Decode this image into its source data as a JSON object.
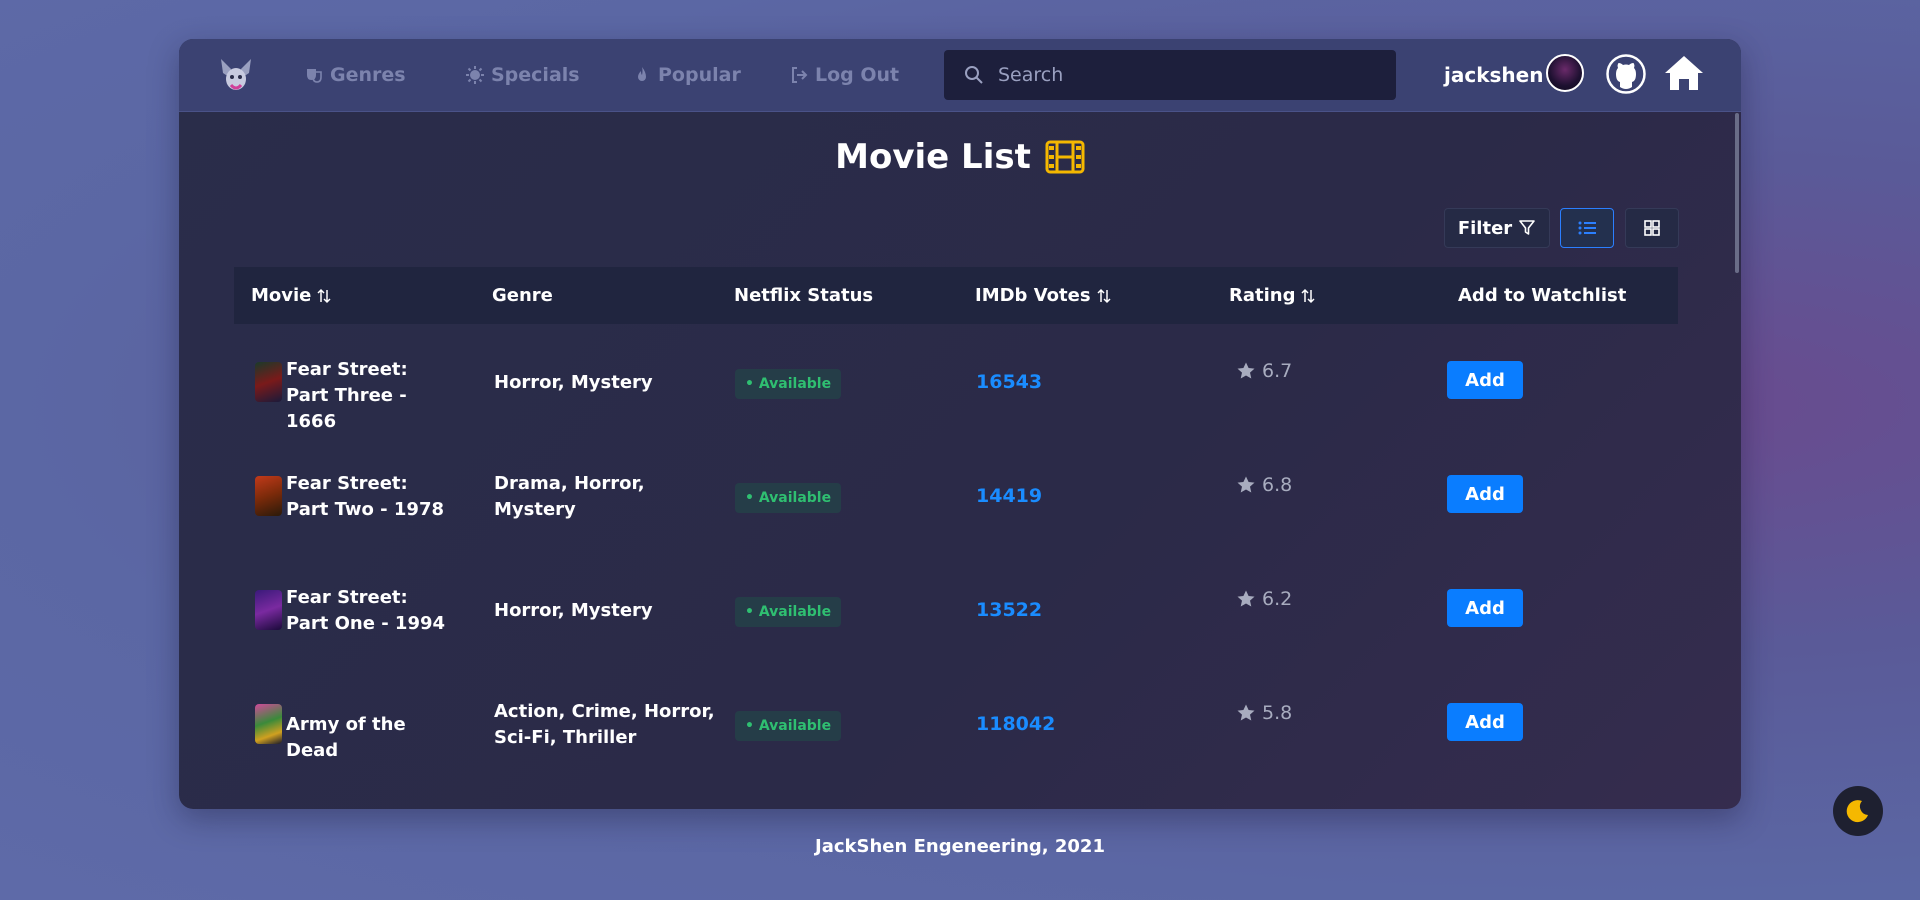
{
  "nav": {
    "genres": "Genres",
    "specials": "Specials",
    "popular": "Popular",
    "logout": "Log Out",
    "search_placeholder": "Search",
    "username": "jackshen"
  },
  "page": {
    "title": "Movie List",
    "filter_label": "Filter"
  },
  "table": {
    "headers": {
      "movie": "Movie",
      "genre": "Genre",
      "status": "Netflix Status",
      "votes": "IMDb Votes",
      "rating": "Rating",
      "watchlist": "Add to Watchlist"
    },
    "rows": [
      {
        "title": "Fear Street: Part Three - 1666",
        "genre": "Horror, Mystery",
        "status": "• Available",
        "votes": "16543",
        "rating": "6.7",
        "action": "Add"
      },
      {
        "title": "Fear Street: Part Two - 1978",
        "genre": "Drama, Horror, Mystery",
        "status": "• Available",
        "votes": "14419",
        "rating": "6.8",
        "action": "Add"
      },
      {
        "title": "Fear Street: Part One - 1994",
        "genre": "Horror, Mystery",
        "status": "• Available",
        "votes": "13522",
        "rating": "6.2",
        "action": "Add"
      },
      {
        "title": "Army of the Dead",
        "genre": "Action, Crime, Horror, Sci-Fi, Thriller",
        "status": "• Available",
        "votes": "118042",
        "rating": "5.8",
        "action": "Add"
      }
    ]
  },
  "footer": {
    "text": "JackShen Engeneering, 2021"
  },
  "colors": {
    "accent": "#0a7dff",
    "votes": "#1a8cff",
    "available": "#2fbf71",
    "navbar": "#3b4272"
  },
  "icons": [
    "logo-icon",
    "genres-icon",
    "specials-icon",
    "popular-icon",
    "logout-icon",
    "search-icon",
    "github-icon",
    "home-icon",
    "film-icon",
    "filter-icon",
    "list-view-icon",
    "grid-view-icon",
    "sort-icon",
    "star-icon",
    "moon-icon"
  ]
}
